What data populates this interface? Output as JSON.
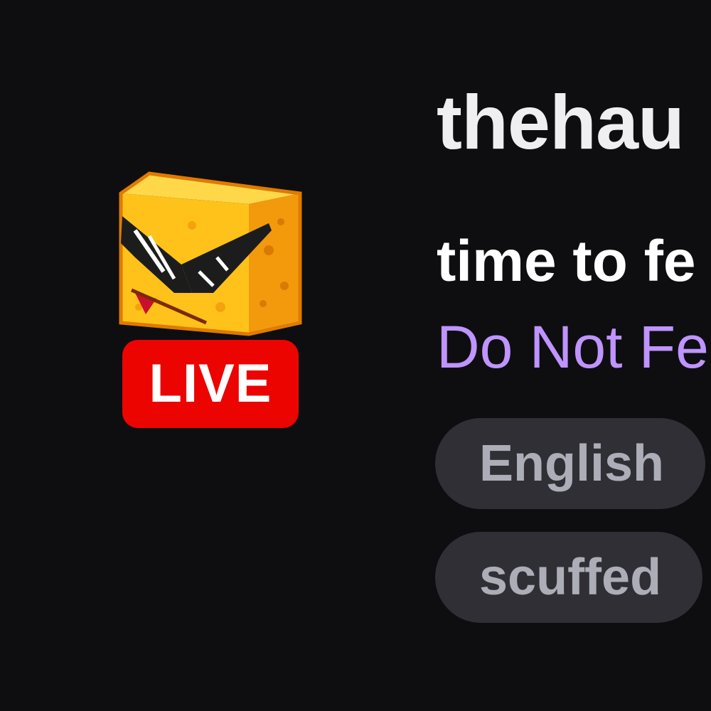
{
  "avatar": {
    "icon": "cheese-block-with-sunglasses-icon",
    "live_label": "LIVE",
    "live_color": "#eb0400"
  },
  "channel": {
    "name": "thehau",
    "title": "time to fe",
    "category": "Do Not Fe"
  },
  "tags": [
    {
      "label": "English"
    },
    {
      "label": "scuffed"
    }
  ],
  "colors": {
    "background": "#0e0e10",
    "category_link": "#bf94ff",
    "tag_bg": "#2f2f35",
    "tag_text": "#adadb8"
  }
}
